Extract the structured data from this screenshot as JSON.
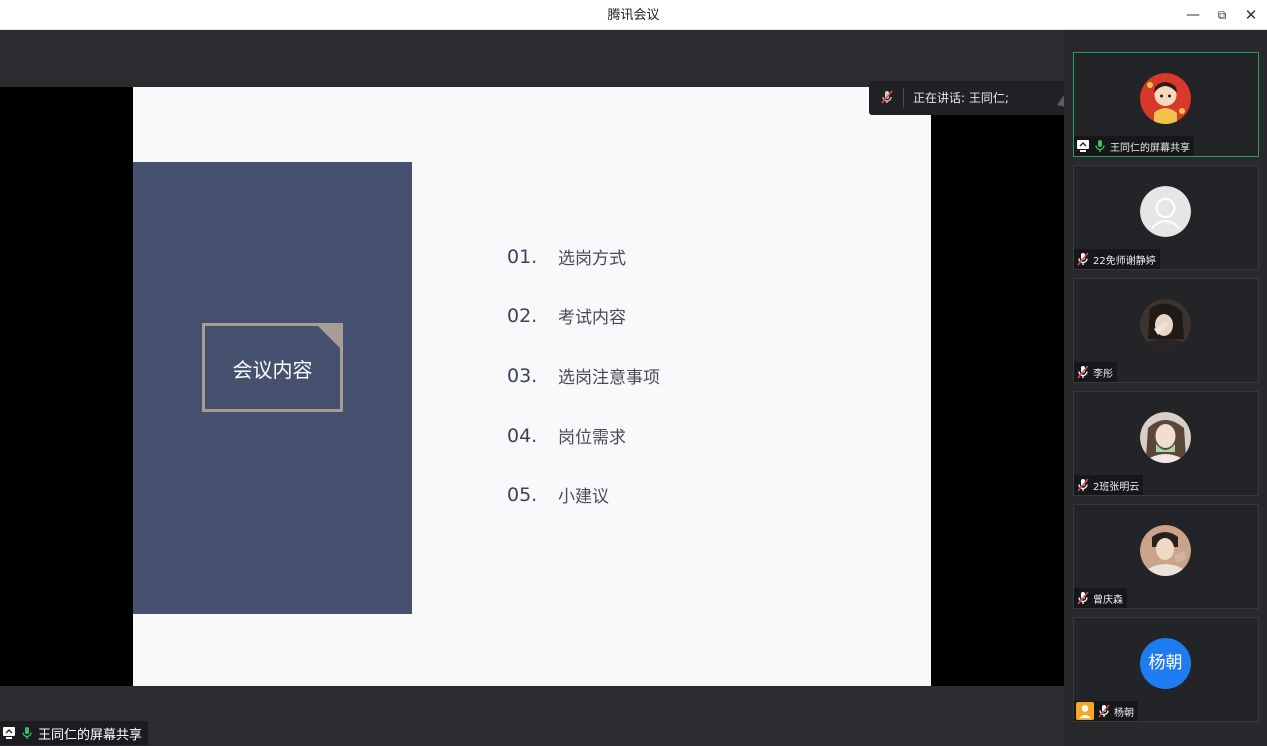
{
  "window": {
    "title": "腾讯会议",
    "controls": {
      "minimize": "—",
      "restore": "⧉",
      "close": "✕"
    }
  },
  "slide": {
    "box_label": "会议内容",
    "agenda": [
      {
        "num": "01.",
        "text": "选岗方式"
      },
      {
        "num": "02.",
        "text": "考试内容"
      },
      {
        "num": "03.",
        "text": "选岗注意事项"
      },
      {
        "num": "04.",
        "text": "岗位需求"
      },
      {
        "num": "05.",
        "text": "小建议"
      }
    ],
    "colors": {
      "block": "#46506f",
      "frame": "#a69e96",
      "background": "#f9f9fb"
    }
  },
  "speaking": {
    "label": "正在讲话: 王同仁;"
  },
  "share_tag": {
    "label": "王同仁的屏幕共享"
  },
  "participants": [
    {
      "name": "王同仁的屏幕共享",
      "avatar": "cartoon-avatar",
      "mic": "mic-on",
      "screen_share": true,
      "active": true
    },
    {
      "name": "22免师谢静婷",
      "avatar": "default-avatar",
      "mic": "mic-muted"
    },
    {
      "name": "李彤",
      "avatar": "photo-avatar",
      "mic": "mic-muted"
    },
    {
      "name": "2班张明云",
      "avatar": "photo-avatar",
      "mic": "mic-muted"
    },
    {
      "name": "曾庆森",
      "avatar": "photo-avatar",
      "mic": "mic-muted"
    },
    {
      "name": "杨朝",
      "avatar_text": "杨朝",
      "avatar_color": "#1f7bf2",
      "mic": "mic-muted",
      "host": true
    }
  ],
  "accent": {
    "active_border": "#2f9a5d",
    "mic_green": "#35c46a",
    "mute_red": "#e5484d"
  }
}
